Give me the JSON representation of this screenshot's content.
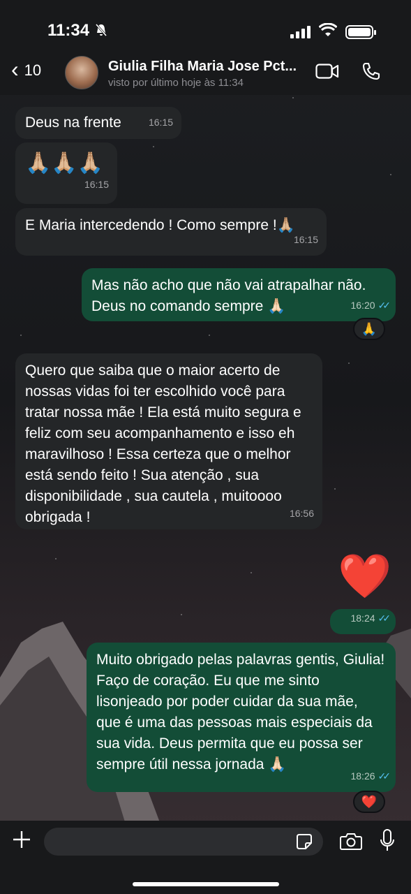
{
  "status_bar": {
    "time": "11:34"
  },
  "header": {
    "back_count": "10",
    "contact_name": "Giulia Filha Maria Jose Pct...",
    "last_seen": "visto por último hoje às 11:34"
  },
  "messages": [
    {
      "direction": "in",
      "text": "Deus na frente",
      "time": "16:15"
    },
    {
      "direction": "in",
      "text": "🙏🏼🙏🏼🙏🏼",
      "time": "16:15"
    },
    {
      "direction": "in",
      "text": "E Maria intercedendo ! Como sempre !🙏🏼",
      "time": "16:15"
    },
    {
      "direction": "out",
      "text": "Mas não acho que não vai atrapalhar não. Deus no comando sempre 🙏🏻",
      "time": "16:20",
      "reaction": "🙏"
    },
    {
      "direction": "in",
      "text": "Quero que saiba que o maior acerto de nossas vidas foi ter escolhido você para tratar nossa mãe ! Ela está muito segura e feliz com seu acompanhamento e isso eh maravilhoso ! Essa certeza que o melhor está sendo feito ! Sua atenção , sua disponibilidade , sua cautela , muitoooo obrigada !",
      "time": "16:56"
    },
    {
      "direction": "out",
      "text": "❤️",
      "time": "18:24"
    },
    {
      "direction": "out",
      "text": "Muito obrigado pelas palavras gentis, Giulia! Faço de coração. Eu que me sinto lisonjeado por poder cuidar da sua mãe, que é uma das pessoas mais especiais da sua vida. Deus permita que eu possa ser sempre útil nessa jornada 🙏🏻",
      "time": "18:26",
      "reaction": "❤️"
    }
  ],
  "colors": {
    "incoming_bubble": "#242628",
    "outgoing_bubble": "#134d37",
    "read_ticks": "#53bdeb"
  },
  "icons": {
    "back": "chevron-left-icon",
    "video": "video-camera-icon",
    "call": "phone-icon",
    "attach": "plus-icon",
    "sticker": "sticker-icon",
    "camera": "camera-icon",
    "mic": "microphone-icon"
  }
}
